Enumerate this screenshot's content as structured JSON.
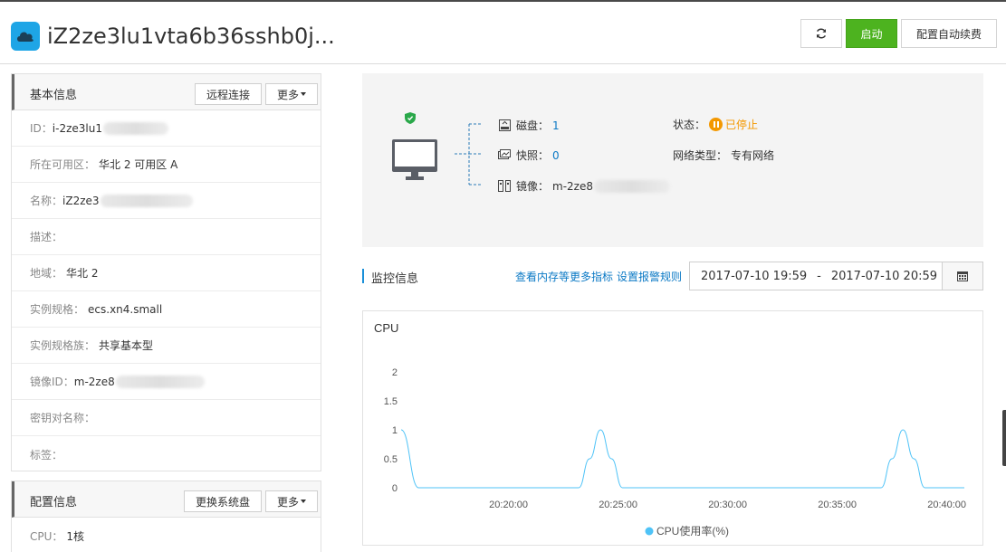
{
  "header": {
    "title": "iZ2ze3lu1vta6b36sshb0j...",
    "refresh_icon": "refresh-icon",
    "start_label": "启动",
    "renew_label": "配置自动续费",
    "colors": {
      "start": "#4db31f",
      "accent": "#1ea5e6"
    }
  },
  "basic_info": {
    "title": "基本信息",
    "remote_label": "远程连接",
    "more_label": "更多",
    "rows": [
      {
        "label": "ID：",
        "value": "i-2ze3lu1"
      },
      {
        "label": "所在可用区：",
        "value": "华北 2 可用区 A"
      },
      {
        "label": "名称：",
        "value": "iZ2ze3"
      },
      {
        "label": "描述：",
        "value": ""
      },
      {
        "label": "地域：",
        "value": "华北 2"
      },
      {
        "label": "实例规格：",
        "value": "ecs.xn4.small"
      },
      {
        "label": "实例规格族：",
        "value": "共享基本型"
      },
      {
        "label": "镜像ID：",
        "value": "m-2ze8"
      },
      {
        "label": "密钥对名称：",
        "value": ""
      },
      {
        "label": "标签：",
        "value": ""
      }
    ]
  },
  "config_info": {
    "title": "配置信息",
    "replace_label": "更换系统盘",
    "more_label": "更多",
    "rows": [
      {
        "label": "CPU：",
        "value": "1核"
      }
    ]
  },
  "summary": {
    "disk_label": "磁盘：",
    "disk_value": "1",
    "snapshot_label": "快照：",
    "snapshot_value": "0",
    "image_label": "镜像：",
    "image_value": "m-2ze8",
    "status_label": "状态：",
    "status_value": "已停止",
    "network_label": "网络类型：",
    "network_value": "专有网络",
    "colors": {
      "stopped": "#f39800",
      "link": "#0b79c5"
    }
  },
  "monitor": {
    "title": "监控信息",
    "more_metrics_link": "查看内存等更多指标",
    "alarm_link": "设置报警规则",
    "date_start": "2017-07-10 19:59",
    "date_sep": "-",
    "date_end": "2017-07-10 20:59"
  },
  "chart_data": {
    "type": "line",
    "title": "CPU",
    "xlabel": "",
    "ylabel": "",
    "ylim": [
      0,
      2
    ],
    "yticks": [
      "0",
      "0.5",
      "1",
      "1.5",
      "2"
    ],
    "xticks": [
      "20:20:00",
      "20:25:00",
      "20:30:00",
      "20:35:00",
      "20:40:00"
    ],
    "xrange_minutes": [
      15.1,
      40.8
    ],
    "grid": false,
    "legend": "bottom",
    "series": [
      {
        "name": "CPU使用率(%)",
        "color": "#4fc3f7",
        "x": [
          15.1,
          15.9,
          16.5,
          23.2,
          23.7,
          24.2,
          24.7,
          25.2,
          37.0,
          37.5,
          38.0,
          38.5,
          39.0,
          40.8
        ],
        "y": [
          1,
          0,
          0,
          0,
          0.5,
          1,
          0.5,
          0,
          0,
          0.5,
          1,
          0.5,
          0,
          0
        ]
      }
    ]
  }
}
